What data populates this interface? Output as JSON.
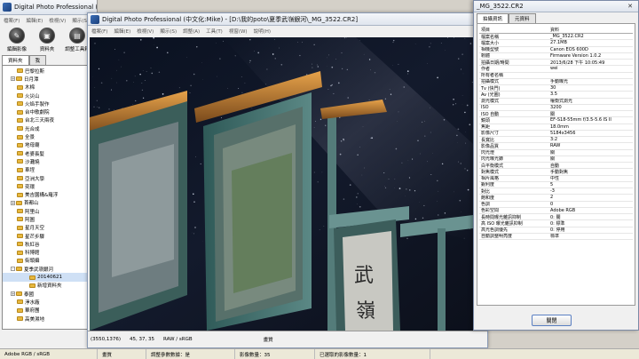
{
  "app": {
    "icon": "dpp-app-icon",
    "back_title": "Digital Photo Professional (中文化:Mike)",
    "main_title": "Digital Photo Professional (中文化:Mike) - [D:\\我的poto\\夏季武嶺銀河\\_MG_3522.CR2]"
  },
  "back_window": {
    "menu": [
      "檔案(F)",
      "編輯(E)",
      "檢視(V)",
      "顯示(S)"
    ],
    "toolbar": [
      {
        "label": "編輯影像",
        "icon": "edit-image-icon"
      },
      {
        "label": "資料夾",
        "icon": "folder-icon"
      },
      {
        "label": "調整工具箱",
        "icon": "toolbox-icon"
      }
    ],
    "tabs": [
      "資料夾",
      "我"
    ],
    "tree": [
      {
        "label": "巴黎拉斯",
        "depth": 1,
        "expander": ""
      },
      {
        "label": "日月潭",
        "depth": 1,
        "expander": "+"
      },
      {
        "label": "木棉",
        "depth": 1,
        "expander": ""
      },
      {
        "label": "火災山",
        "depth": 1,
        "expander": ""
      },
      {
        "label": "火焰手製作",
        "depth": 1,
        "expander": ""
      },
      {
        "label": "台中歌劇院",
        "depth": 1,
        "expander": ""
      },
      {
        "label": "台北三天兩夜",
        "depth": 1,
        "expander": ""
      },
      {
        "label": "光合成",
        "depth": 1,
        "expander": ""
      },
      {
        "label": "全景",
        "depth": 1,
        "expander": ""
      },
      {
        "label": "地母廟",
        "depth": 1,
        "expander": ""
      },
      {
        "label": "老婆長髮",
        "depth": 1,
        "expander": ""
      },
      {
        "label": "沙灘燒",
        "depth": 1,
        "expander": ""
      },
      {
        "label": "車埕",
        "depth": 1,
        "expander": ""
      },
      {
        "label": "亞洲大學",
        "depth": 1,
        "expander": ""
      },
      {
        "label": "奕環",
        "depth": 1,
        "expander": ""
      },
      {
        "label": "美吉園構&羅浮",
        "depth": 1,
        "expander": ""
      },
      {
        "label": "首都山",
        "depth": 1,
        "expander": "+"
      },
      {
        "label": "阿里山",
        "depth": 1,
        "expander": ""
      },
      {
        "label": "阿圖",
        "depth": 1,
        "expander": ""
      },
      {
        "label": "星月天空",
        "depth": 1,
        "expander": ""
      },
      {
        "label": "星芒步驟",
        "depth": 1,
        "expander": ""
      },
      {
        "label": "秋紅谷",
        "depth": 1,
        "expander": ""
      },
      {
        "label": "科博館",
        "depth": 1,
        "expander": ""
      },
      {
        "label": "街頭攝",
        "depth": 1,
        "expander": ""
      },
      {
        "label": "夏季武嶺銀河",
        "depth": 1,
        "expander": "-"
      },
      {
        "label": "20140621",
        "depth": 2,
        "expander": ""
      },
      {
        "label": "新增資料夾",
        "depth": 2,
        "expander": ""
      },
      {
        "label": "泰國",
        "depth": 1,
        "expander": "+"
      },
      {
        "label": "淨水廠",
        "depth": 1,
        "expander": ""
      },
      {
        "label": "華府團",
        "depth": 1,
        "expander": ""
      },
      {
        "label": "高美濕地",
        "depth": 1,
        "expander": ""
      }
    ]
  },
  "main_window": {
    "menu": [
      "檔案(F)",
      "編輯(E)",
      "檢視(V)",
      "顯示(S)",
      "調整(A)",
      "工具(T)",
      "視窗(W)",
      "說明(H)"
    ],
    "image_status": {
      "coords": "(3550,1376)",
      "rgb": "45, 37, 35",
      "mode": "RAW / sRGB",
      "quality": "畫質"
    }
  },
  "info_window": {
    "title": "_MG_3522.CR2",
    "tabs": [
      "拍攝資訊",
      "元資料"
    ],
    "columns": [
      "項目",
      "資料"
    ],
    "rows": [
      {
        "k": "檔案名稱",
        "v": "_MG_3522.CR2"
      },
      {
        "k": "檔案大小",
        "v": "27.1MB"
      },
      {
        "k": "相機型號",
        "v": "Canon EOS 600D"
      },
      {
        "k": "韌體",
        "v": "Firmware Version 1.0.2"
      },
      {
        "k": "拍攝日期/時間",
        "v": "2013/6/28 下午 10:05:49"
      },
      {
        "k": "作者",
        "v": "wei"
      },
      {
        "k": "所有者名稱",
        "v": ""
      },
      {
        "k": "拍攝模式",
        "v": "手動曝光"
      },
      {
        "k": "Tv (快門)",
        "v": "30"
      },
      {
        "k": "Av (光圈)",
        "v": "3.5"
      },
      {
        "k": "測光模式",
        "v": "權衡式測光"
      },
      {
        "k": "ISO",
        "v": "3200"
      },
      {
        "k": "ISO 自動",
        "v": "關"
      },
      {
        "k": "鏡頭",
        "v": "EF-S18-55mm f/3.5-5.6 IS II"
      },
      {
        "k": "焦距",
        "v": "18.0mm"
      },
      {
        "k": "影像尺寸",
        "v": "5184x3456"
      },
      {
        "k": "長寬比",
        "v": "3:2"
      },
      {
        "k": "影像品質",
        "v": "RAW"
      },
      {
        "k": "閃光燈",
        "v": "關"
      },
      {
        "k": "閃光曝光錄",
        "v": "關"
      },
      {
        "k": "白平衡模式",
        "v": "自動"
      },
      {
        "k": "對焦模式",
        "v": "手動對焦"
      },
      {
        "k": "相片風格",
        "v": "中性"
      },
      {
        "k": "銳利度",
        "v": "5"
      },
      {
        "k": "對比",
        "v": "-3"
      },
      {
        "k": "飽和度",
        "v": "2"
      },
      {
        "k": "色調",
        "v": "0"
      },
      {
        "k": "色彩空間",
        "v": "Adobe RGB"
      },
      {
        "k": "長時間曝光雜訊抑制",
        "v": "0: 關"
      },
      {
        "k": "高 ISO 曝光雜訊抑制",
        "v": "0: 標準"
      },
      {
        "k": "高光色調優先",
        "v": "0: 停用"
      },
      {
        "k": "自動調整明亮度",
        "v": "標準"
      }
    ],
    "close_button": "關閉"
  },
  "statusbar": {
    "color_mode": "Adobe RGB / sRGB",
    "quality": "畫質",
    "adjust": "調整參數數據：是",
    "count": "影像數量：35",
    "selected": "已選取的影像數量：1"
  },
  "photo": {
    "sign_text_1": "武",
    "sign_text_2": "嶺"
  }
}
